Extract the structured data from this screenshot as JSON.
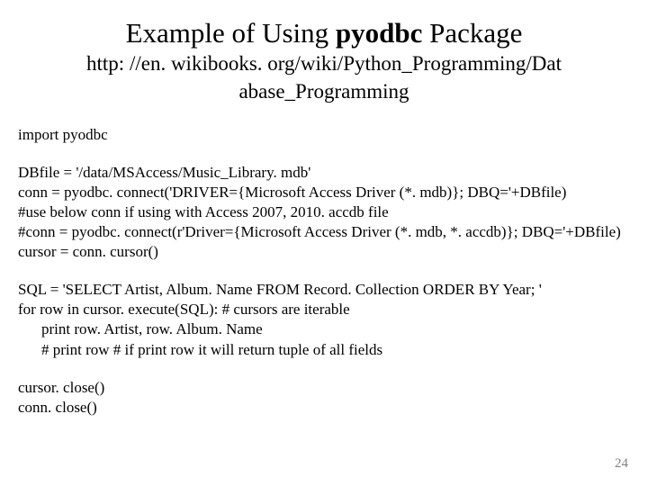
{
  "title": {
    "pre": "Example of Using ",
    "bold": "pyodbc",
    "post": " Package"
  },
  "url_line1": "http: //en. wikibooks. org/wiki/Python_Programming/Dat",
  "url_line2": "abase_Programming",
  "code": {
    "l01": "import pyodbc",
    "l02": "DBfile = '/data/MSAccess/Music_Library. mdb'",
    "l03": "conn = pyodbc. connect('DRIVER={Microsoft Access Driver (*. mdb)}; DBQ='+DBfile)",
    "l04": "#use below conn if using with Access 2007, 2010. accdb file",
    "l05": "#conn = pyodbc. connect(r'Driver={Microsoft Access Driver (*. mdb, *. accdb)}; DBQ='+DBfile)",
    "l06": "cursor = conn. cursor()",
    "l07": "SQL = 'SELECT Artist, Album. Name FROM Record. Collection ORDER BY Year; '",
    "l08": "for row in cursor. execute(SQL): # cursors are iterable",
    "l09": "print row. Artist, row. Album. Name",
    "l10": "# print row # if print row it will return tuple of all fields",
    "l11": "cursor. close()",
    "l12": "conn. close()"
  },
  "pagenum": "24"
}
